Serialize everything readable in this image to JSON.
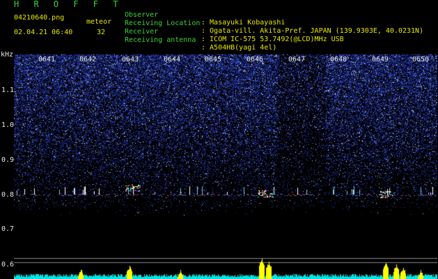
{
  "header": {
    "title": "H R O F F T",
    "filename": "04210640.png",
    "meteor_label": "meteor",
    "datetime": "02.04.21 06:40",
    "meteor_count": "32",
    "rows": [
      {
        "label": "Observer",
        "value": ": Masayuki Kobayashi"
      },
      {
        "label": "Receiving Location",
        "value": ": Ogata-vill. Akita-Pref. JAPAN (139.9303E, 40.0231N)"
      },
      {
        "label": "Receiver",
        "value": ": ICOM IC-575 53.7492(@LCD)MHz USB"
      },
      {
        "label": "Receiving antenna",
        "value": ": A504HB(yagi 4el)"
      }
    ]
  },
  "axis": {
    "unit": "kHz",
    "y_ticks": [
      "1.1",
      "1.0",
      "0.9",
      "0.8",
      "0.7",
      "0.6"
    ],
    "x_ticks": [
      "0641",
      "0642",
      "0643",
      "0644",
      "0645",
      "0646",
      "0647",
      "0648",
      "0649",
      "0650"
    ]
  },
  "colors": {
    "header_label": "#3dd33d",
    "header_value": "#e8e800",
    "background": "#000000",
    "noise": "#1a2a9a",
    "signal": "#ffffff",
    "hist": "#00e5e5",
    "hist_peak": "#ffff00"
  }
}
